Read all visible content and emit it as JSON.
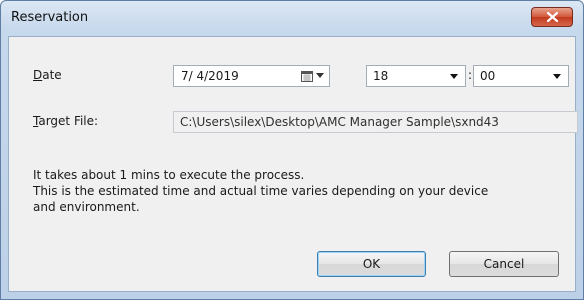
{
  "window": {
    "title": "Reservation"
  },
  "form": {
    "date_label_underline": "D",
    "date_label_rest": "ate",
    "date_value": "7/ 4/2019",
    "hour_value": "18",
    "colon": ":",
    "minute_value": "00",
    "target_label_underline": "T",
    "target_label_rest": "arget File:",
    "target_value": "C:\\Users\\silex\\Desktop\\AMC Manager Sample\\sxnd43"
  },
  "message": {
    "line1": "It takes about 1 mins to execute the process.",
    "line2": "This is the estimated time and actual time varies depending on your device",
    "line3": "and environment."
  },
  "buttons": {
    "ok": "OK",
    "cancel": "Cancel"
  }
}
